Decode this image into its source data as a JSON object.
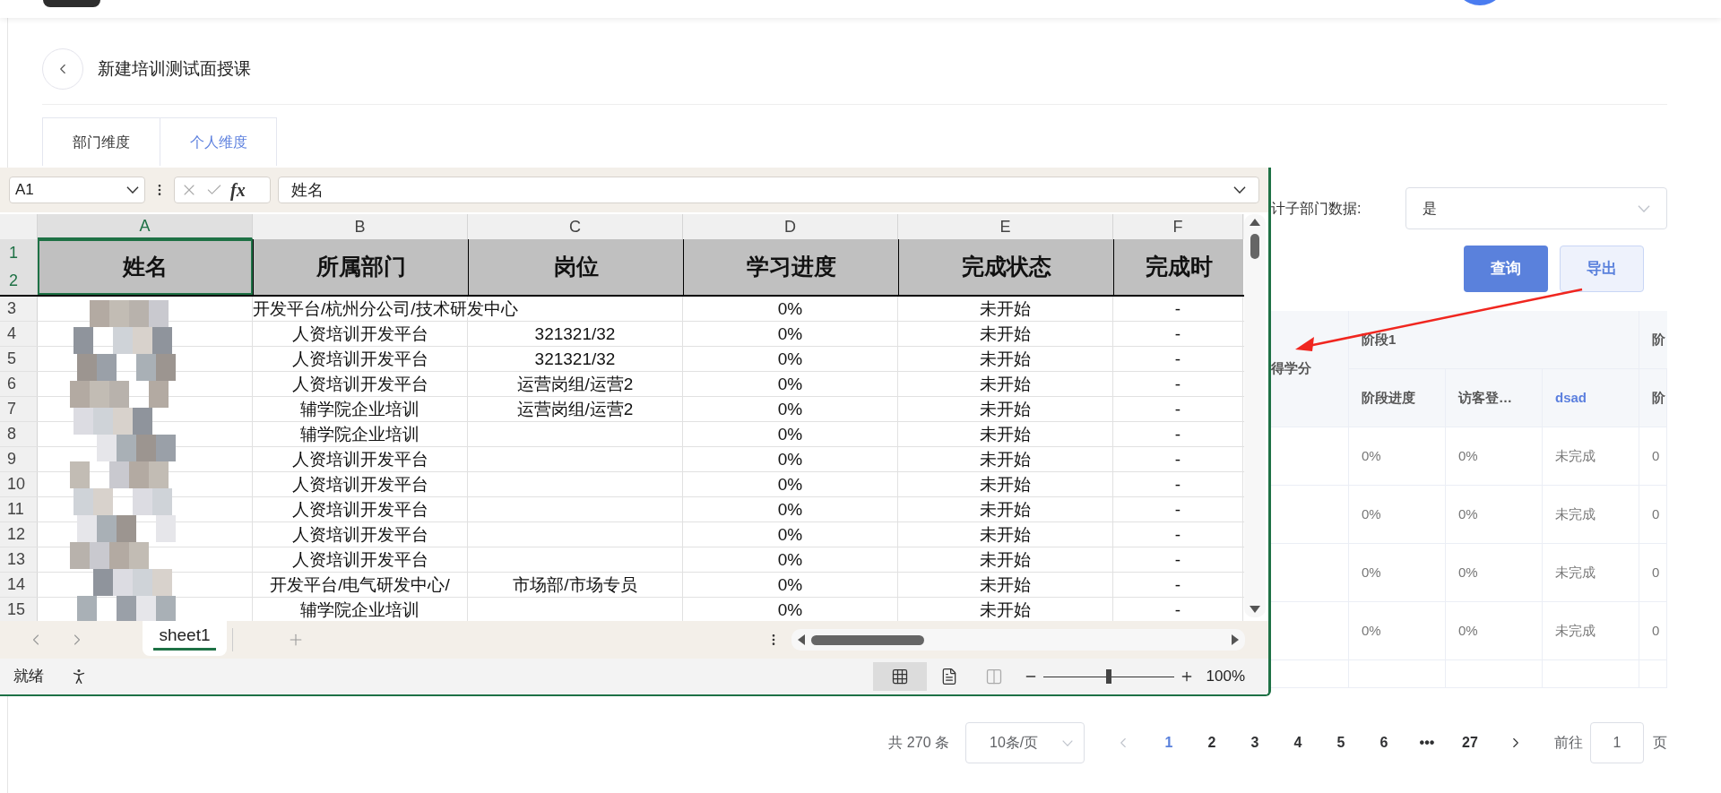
{
  "page": {
    "title": "新建培训测试面授课"
  },
  "tabs": [
    {
      "label": "部门维度",
      "selected": false
    },
    {
      "label": "个人维度",
      "selected": true
    }
  ],
  "filter": {
    "label": "计子部门数据:",
    "value": "是"
  },
  "buttons": [
    {
      "label": "查询",
      "kind": "primary"
    },
    {
      "label": "导出",
      "kind": "secondary"
    }
  ],
  "table": {
    "first_header": "得学分",
    "group_headers": [
      "阶段1",
      "阶"
    ],
    "columns": [
      {
        "label": "阶段进度",
        "link": false
      },
      {
        "label": "访客登…",
        "link": false
      },
      {
        "label": "dsad",
        "link": true
      },
      {
        "label": "阶",
        "link": false
      }
    ],
    "rows": [
      [
        "0%",
        "0%",
        "未完成",
        "0"
      ],
      [
        "0%",
        "0%",
        "未完成",
        "0"
      ],
      [
        "0%",
        "0%",
        "未完成",
        "0"
      ],
      [
        "0%",
        "0%",
        "未完成",
        "0"
      ]
    ]
  },
  "pagination": {
    "total": "共 270 条",
    "page_size": "10条/页",
    "pages": [
      {
        "label": "1",
        "selected": true
      },
      {
        "label": "2",
        "selected": false
      },
      {
        "label": "3",
        "selected": false
      },
      {
        "label": "4",
        "selected": false
      },
      {
        "label": "5",
        "selected": false
      },
      {
        "label": "6",
        "selected": false
      },
      {
        "label": "•••",
        "selected": false
      },
      {
        "label": "27",
        "selected": false
      }
    ],
    "goto_label": "前往",
    "goto_value": "1",
    "page_suffix": "页"
  },
  "spreadsheet": {
    "name_box": "A1",
    "function_label": "fx",
    "formula": "姓名",
    "columns": [
      {
        "letter": "A",
        "selected": true
      },
      {
        "letter": "B",
        "selected": false
      },
      {
        "letter": "C",
        "selected": false
      },
      {
        "letter": "D",
        "selected": false
      },
      {
        "letter": "E",
        "selected": false
      },
      {
        "letter": "F",
        "selected": false
      }
    ],
    "header_rows": [
      {
        "number": "1",
        "selected": true
      },
      {
        "number": "2",
        "selected": true
      }
    ],
    "headers": [
      "姓名",
      "所属部门",
      "岗位",
      "学习进度",
      "完成状态",
      "完成时"
    ],
    "rows": [
      {
        "number": "3",
        "cells": [
          "",
          "开发平台/杭州分公司/技术研发中心",
          "",
          "0%",
          "未开始",
          "-"
        ]
      },
      {
        "number": "4",
        "cells": [
          "",
          "人资培训开发平台",
          "321321/32",
          "0%",
          "未开始",
          "-"
        ]
      },
      {
        "number": "5",
        "cells": [
          "",
          "人资培训开发平台",
          "321321/32",
          "0%",
          "未开始",
          "-"
        ]
      },
      {
        "number": "6",
        "cells": [
          "",
          "人资培训开发平台",
          "运营岗组/运营2",
          "0%",
          "未开始",
          "-"
        ]
      },
      {
        "number": "7",
        "cells": [
          "",
          "辅学院企业培训",
          "运营岗组/运营2",
          "0%",
          "未开始",
          "-"
        ]
      },
      {
        "number": "8",
        "cells": [
          "",
          "辅学院企业培训",
          "",
          "0%",
          "未开始",
          "-"
        ]
      },
      {
        "number": "9",
        "cells": [
          "",
          "人资培训开发平台",
          "",
          "0%",
          "未开始",
          "-"
        ]
      },
      {
        "number": "10",
        "cells": [
          "",
          "人资培训开发平台",
          "",
          "0%",
          "未开始",
          "-"
        ]
      },
      {
        "number": "11",
        "cells": [
          "",
          "人资培训开发平台",
          "",
          "0%",
          "未开始",
          "-"
        ]
      },
      {
        "number": "12",
        "cells": [
          "",
          "人资培训开发平台",
          "",
          "0%",
          "未开始",
          "-"
        ]
      },
      {
        "number": "13",
        "cells": [
          "",
          "人资培训开发平台",
          "",
          "0%",
          "未开始",
          "-"
        ]
      },
      {
        "number": "14",
        "cells": [
          "",
          "开发平台/电气研发中心/",
          "市场部/市场专员",
          "0%",
          "未开始",
          "-"
        ]
      },
      {
        "number": "15",
        "cells": [
          "",
          "辅学院企业培训",
          "",
          "0%",
          "未开始",
          "-"
        ]
      }
    ],
    "sheet_tabs": [
      {
        "label": "sheet1",
        "selected": true
      }
    ],
    "status": "就绪",
    "zoom_slider": {
      "level": 0.5
    },
    "zoom": "100%"
  }
}
